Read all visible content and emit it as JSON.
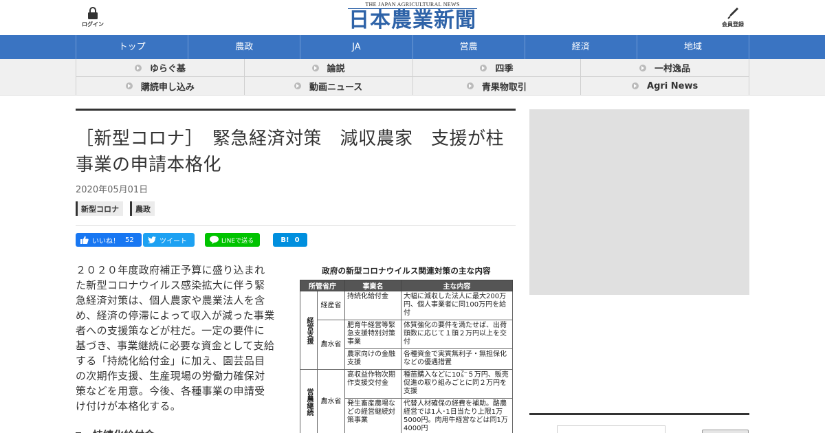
{
  "header": {
    "login_label": "ログイン",
    "member_label": "会員登録",
    "logo_en": "THE JAPAN AGRICULTURAL NEWS",
    "logo_ja": "日本農業新聞",
    "brand_color": "#2e63a8"
  },
  "nav_primary": {
    "color": "#3a74c2",
    "items": [
      "トップ",
      "農政",
      "JA",
      "営農",
      "経済",
      "地域"
    ]
  },
  "nav_secondary": {
    "items": [
      "ゆらぐ基",
      "論説",
      "四季",
      "一村逸品",
      "購読申し込み",
      "動画ニュース",
      "青果物取引",
      "Agri News"
    ]
  },
  "article": {
    "title": "［新型コロナ］　緊急経済対策　減収農家　支援が柱　事業の申請本格化",
    "date": "2020年05月01日",
    "tags": [
      "新型コロナ",
      "農政"
    ],
    "share": {
      "facebook_label": "いいね！",
      "facebook_count": "52",
      "tweet_label": "ツイート",
      "line_label": "LINEで送る",
      "hatena_label": "B!",
      "hatena_count": "0"
    },
    "body": "２０２０年度政府補正予算に盛り込まれた新型コロナウイルス感染拡大に伴う緊急経済対策は、個人農家や農業法人を含め、経済の停滞によって収入が減った事業者への支援策などが柱だ。一定の要件に基づき、事業継続に必要な資金として支給する「持続化給付金」に加え、園芸品目の次期作支援、生産現場の労働力確保対策などを用意。今後、各種事業の申請受け付けが本格化する。",
    "subheading": "持続化給付金"
  },
  "figure": {
    "title": "政府の新型コロナウイルス関連対策の主な内容",
    "headers": [
      "所管省庁",
      "事業名",
      "主な内容"
    ],
    "categories": [
      "経営支援",
      "営農継続"
    ],
    "rows": [
      {
        "dept": "経産省",
        "name": "持続化給付金",
        "content": "大幅に減収した法人に最大200万円、個人事業者に同100万円を給付"
      },
      {
        "dept": "農水省",
        "name": "肥育牛経営等緊急支援特別対策事業",
        "content": "体質強化の要件を満たせば、出荷頭数に応じて１頭２万円以上を交付"
      },
      {
        "dept": "",
        "name": "農家向けの金融支援",
        "content": "各種資金で実質無利子・無担保化などの優遇措置"
      },
      {
        "dept": "農水省",
        "name": "高収益作物次期作支援交付金",
        "content": "種苗購入などに10㌃５万円、販売促進の取り組みごとに同２万円を支援"
      },
      {
        "dept": "",
        "name": "発生畜産農場などの経営継続対策事業",
        "content": "代替人材確保の経費を補助。酪農経営では1人･1日当たり上限1万5000円。肉用牛経営などは同1万4000円"
      }
    ]
  }
}
